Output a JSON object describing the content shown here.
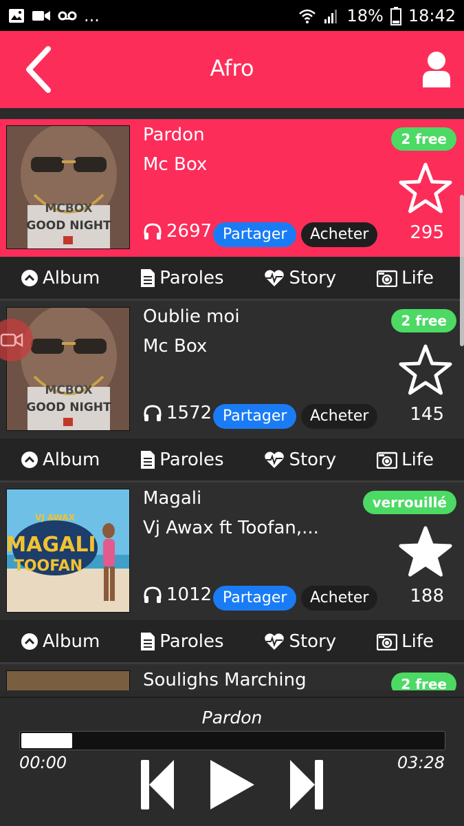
{
  "status_bar": {
    "battery": "18%",
    "time": "18:42",
    "more": "..."
  },
  "header": {
    "title": "Afro"
  },
  "songs": [
    {
      "title": "Pardon",
      "artist": "Mc Box",
      "badge": "2 free",
      "plays": "2697",
      "share_label": "Partager",
      "buy_label": "Acheter",
      "likes": "295",
      "star_filled": false,
      "active": true,
      "cover_text": "MCBOX GOOD NIGHT"
    },
    {
      "title": "Oublie moi",
      "artist": "Mc Box",
      "badge": "2 free",
      "plays": "1572",
      "share_label": "Partager",
      "buy_label": "Acheter",
      "likes": "145",
      "star_filled": false,
      "active": false,
      "cover_text": "MCBOX GOOD NIGHT"
    },
    {
      "title": "Magali",
      "artist": "Vj Awax ft Toofan,...",
      "badge": "verrouillé",
      "plays": "1012",
      "share_label": "Partager",
      "buy_label": "Acheter",
      "likes": "188",
      "star_filled": true,
      "active": false,
      "cover_text": "MAGALI TOOFAN"
    },
    {
      "title": "Soulighs Marching",
      "artist": "",
      "badge": "2 free",
      "plays": "",
      "share_label": "",
      "buy_label": "",
      "likes": "",
      "star_filled": false,
      "active": false,
      "cover_text": ""
    }
  ],
  "actions": {
    "album": "Album",
    "paroles": "Paroles",
    "story": "Story",
    "life": "Life"
  },
  "player": {
    "title": "Pardon",
    "current_time": "00:00",
    "total_time": "03:28",
    "progress": 0.12
  },
  "colors": {
    "accent": "#fd2d5a",
    "badge_green": "#4cd964",
    "share_blue": "#1a7cf5",
    "background": "#2b2b2b"
  }
}
